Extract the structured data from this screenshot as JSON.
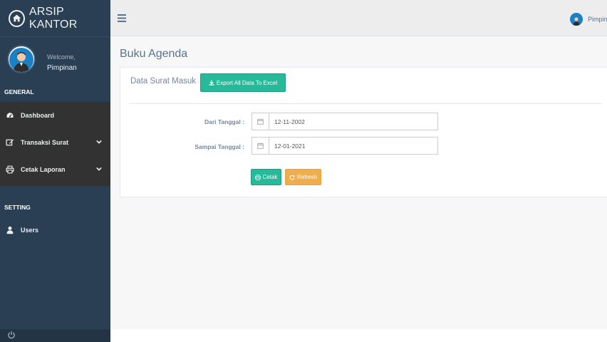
{
  "sidebar": {
    "brand": "ARSIP KANTOR",
    "welcome": "Welcome,",
    "user_name": "Pimpinan",
    "general_title": "GENERAL",
    "setting_title": "SETTING",
    "items": [
      {
        "label": "Dashboard",
        "icon": "tachometer-icon"
      },
      {
        "label": "Transaksi Surat",
        "icon": "edit-icon",
        "chevron": "chevron-down-icon"
      },
      {
        "label": "Cetak Laporan",
        "icon": "print-icon",
        "chevron": "chevron-down-icon"
      },
      {
        "label": "Users",
        "icon": "user-icon"
      }
    ],
    "footer_icon": "power-icon"
  },
  "topnav": {
    "user_name": "Pimpinan",
    "menu_icon": "hamburger-icon"
  },
  "main": {
    "page_title": "Buku Agenda",
    "panel_title": "Data Surat Masuk",
    "export_label": "Export All Data To Excel",
    "dari_label": "Dari Tanggal :",
    "dari_value": "12-11-2002",
    "sampai_label": "Sampai Tanggal :",
    "sampai_value": "12-01-2021",
    "cetak_label": "Cetak",
    "refresh_label": "Refresh"
  },
  "colors": {
    "sidebar": "#2a3f54",
    "primary": "#26b99a",
    "warning": "#f0ad4e",
    "title": "#5a738e"
  }
}
